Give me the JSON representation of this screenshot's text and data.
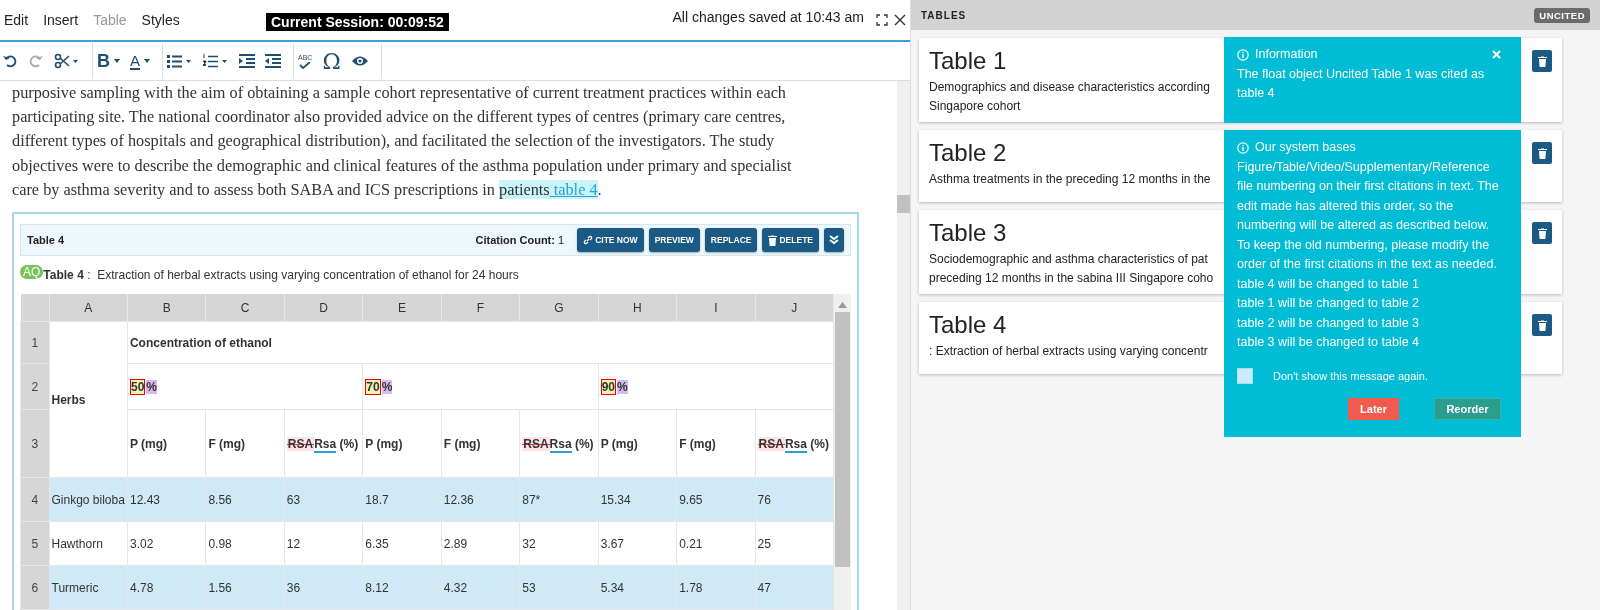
{
  "menu": [
    {
      "label": "Edit",
      "disabled": false
    },
    {
      "label": "Insert",
      "disabled": false
    },
    {
      "label": "Table",
      "disabled": true
    },
    {
      "label": "Styles",
      "disabled": false
    }
  ],
  "session": "Current Session: 00:09:52",
  "save_status": "All changes saved at 10:43 am",
  "toolbar": {
    "bold_label": "B",
    "font_color_label": "A",
    "special_char_label": "Ω",
    "spell_label": "ABC"
  },
  "paragraph": {
    "lines": [
      "purposive sampling with the aim of obtaining a sample cohort representative of current treatment practices within each",
      "participating site. The national coordinator also provided advice on the different types of centres (primary care centres,",
      "different types of hospitals and geographical distribution), and facilitated the selection of the investigators. The study",
      "objectives were to describe the demographic and clinical features of the asthma population under primary and specialist",
      "care by asthma severity and to assess both SABA and ICS prescriptions in "
    ],
    "highlight": "patients",
    "link": " table 4",
    "end": "."
  },
  "table_widget": {
    "label": "Table 4",
    "citation_label": "Citation Count:",
    "citation_count": "1",
    "buttons": [
      {
        "kind": "cite",
        "label": "CITE NOW"
      },
      {
        "kind": "plain",
        "label": "PREVIEW"
      },
      {
        "kind": "plain",
        "label": "REPLACE"
      },
      {
        "kind": "delete",
        "label": "DELETE"
      }
    ],
    "query_badge": "AQ",
    "caption_label": "Table 4",
    "caption_sep": ":",
    "caption": "Extraction of herbal extracts using varying concentration of ethanol for 24 hours"
  },
  "grid": {
    "columns": [
      "A",
      "B",
      "C",
      "D",
      "E",
      "F",
      "G",
      "H",
      "I",
      "J"
    ],
    "row_numbers": [
      "1",
      "2",
      "3",
      "4",
      "5",
      "6"
    ],
    "herbs_label": "Herbs",
    "group_heading": "Concentration of ethanol",
    "concentrations": [
      [
        {
          "text": "50",
          "kind": "query"
        },
        {
          "text": "%",
          "kind": "comment"
        }
      ],
      [
        {
          "text": "70",
          "kind": "query"
        },
        {
          "text": "%",
          "kind": "comment"
        }
      ],
      [
        {
          "text": "90",
          "kind": "query"
        },
        {
          "text": "%",
          "kind": "comment"
        }
      ]
    ],
    "subheadings": [
      [
        {
          "text": "P (mg)",
          "kind": "plain"
        }
      ],
      [
        {
          "text": "F (mg)",
          "kind": "plain"
        }
      ],
      [
        {
          "text": "RSA",
          "kind": "deleted"
        },
        {
          "text": "Rsa",
          "kind": "inserted"
        },
        {
          "text": " (%)",
          "kind": "plain"
        }
      ],
      [
        {
          "text": "P (mg)",
          "kind": "plain"
        }
      ],
      [
        {
          "text": "F (mg)",
          "kind": "plain"
        }
      ],
      [
        {
          "text": "RSA",
          "kind": "deleted"
        },
        {
          "text": "Rsa",
          "kind": "inserted"
        },
        {
          "text": " (%)",
          "kind": "plain"
        }
      ],
      [
        {
          "text": "P (mg)",
          "kind": "plain"
        }
      ],
      [
        {
          "text": "F (mg)",
          "kind": "plain"
        }
      ],
      [
        {
          "text": "RSA",
          "kind": "deleted"
        },
        {
          "text": "Rsa",
          "kind": "inserted"
        },
        {
          "text": " (%)",
          "kind": "plain"
        }
      ]
    ],
    "rows": [
      [
        "Ginkgo biloba",
        "12.43",
        "8.56",
        "63",
        "18.7",
        "12.36",
        "87*",
        "15.34",
        "9.65",
        "76"
      ],
      [
        "Hawthorn",
        "3.02",
        "0.98",
        "12",
        "6.35",
        "2.89",
        "32",
        "3.67",
        "0.21",
        "25"
      ],
      [
        "Turmeric",
        "4.78",
        "1.56",
        "36",
        "8.12",
        "4.32",
        "53",
        "5.34",
        "1.78",
        "47"
      ]
    ]
  },
  "panel": {
    "title": "TABLES",
    "badge": "UNCITED",
    "cards": [
      {
        "title": "Table 1",
        "lines": [
          "Demographics and disease characteristics according",
          "Singapore cohort"
        ]
      },
      {
        "title": "Table 2",
        "lines": [
          "Asthma treatments in the preceding 12 months in the"
        ]
      },
      {
        "title": "Table 3",
        "lines": [
          "Sociodemographic and asthma characteristics of pat",
          "preceding 12 months in the sabina III Singapore coho"
        ]
      },
      {
        "title": "Table 4",
        "lines": [
          ":  Extraction of herbal extracts using varying concentr"
        ]
      }
    ]
  },
  "toasts": [
    {
      "title": "Information",
      "body": [
        "The float object Uncited Table 1 was cited as table 4"
      ]
    },
    {
      "title": "Our system bases",
      "body": [
        "Figure/Table/Video/Supplementary/Reference file numbering on their first citations in text. The edit made has altered this order, so the numbering will be altered as described below. To keep the old numbering, please modify the order of the first citations in the text as needed.",
        "table 4 will be changed to table 1",
        "table 1 will be changed to table 2",
        "table 2 will be changed to table 3",
        "table 3 will be changed to table 4"
      ],
      "checkbox": {
        "label": "Don't show this message again.",
        "checked": false
      },
      "buttons": [
        {
          "kind": "later",
          "label": "Later"
        },
        {
          "kind": "reorder",
          "label": "Reorder"
        }
      ]
    }
  ]
}
